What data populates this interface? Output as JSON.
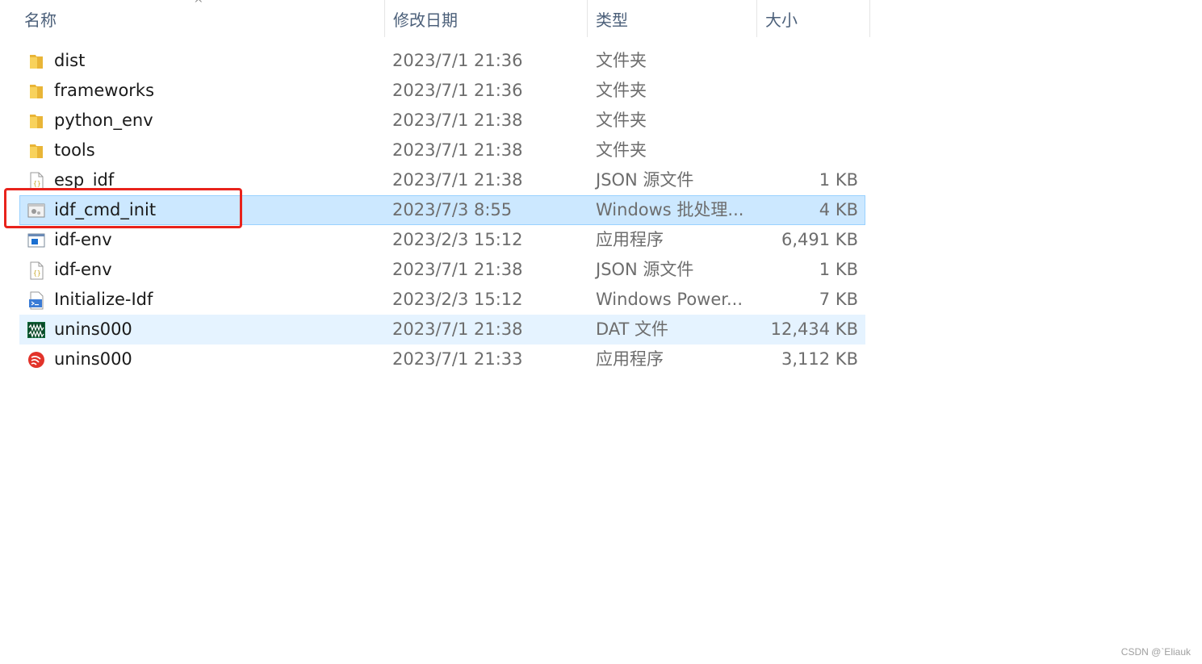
{
  "columns": {
    "name": "名称",
    "date": "修改日期",
    "type": "类型",
    "size": "大小"
  },
  "sort_indicator": "^",
  "files": [
    {
      "name": "dist",
      "date": "2023/7/1 21:36",
      "type": "文件夹",
      "size": "",
      "icon": "folder-icon"
    },
    {
      "name": "frameworks",
      "date": "2023/7/1 21:36",
      "type": "文件夹",
      "size": "",
      "icon": "folder-icon"
    },
    {
      "name": "python_env",
      "date": "2023/7/1 21:38",
      "type": "文件夹",
      "size": "",
      "icon": "folder-icon"
    },
    {
      "name": "tools",
      "date": "2023/7/1 21:38",
      "type": "文件夹",
      "size": "",
      "icon": "folder-icon"
    },
    {
      "name": "esp_idf",
      "date": "2023/7/1 21:38",
      "type": "JSON 源文件",
      "size": "1 KB",
      "icon": "json-file-icon"
    },
    {
      "name": "idf_cmd_init",
      "date": "2023/7/3 8:55",
      "type": "Windows 批处理...",
      "size": "4 KB",
      "icon": "batch-file-icon",
      "state": "selected"
    },
    {
      "name": "idf-env",
      "date": "2023/2/3 15:12",
      "type": "应用程序",
      "size": "6,491 KB",
      "icon": "application-icon"
    },
    {
      "name": "idf-env",
      "date": "2023/7/1 21:38",
      "type": "JSON 源文件",
      "size": "1 KB",
      "icon": "json-file-icon"
    },
    {
      "name": "Initialize-Idf",
      "date": "2023/2/3 15:12",
      "type": "Windows Power...",
      "size": "7 KB",
      "icon": "powershell-script-icon"
    },
    {
      "name": "unins000",
      "date": "2023/7/1 21:38",
      "type": "DAT 文件",
      "size": "12,434 KB",
      "icon": "dat-file-icon",
      "state": "hover"
    },
    {
      "name": "unins000",
      "date": "2023/7/1 21:33",
      "type": "应用程序",
      "size": "3,112 KB",
      "icon": "espressif-app-icon"
    }
  ],
  "watermark": "CSDN @`Eliauk",
  "colors": {
    "selected_bg": "#cce8ff",
    "selected_border": "#99d1ff",
    "hover_bg": "#e5f3ff",
    "highlight_box": "#e8231c",
    "folder": "#f4c542"
  }
}
